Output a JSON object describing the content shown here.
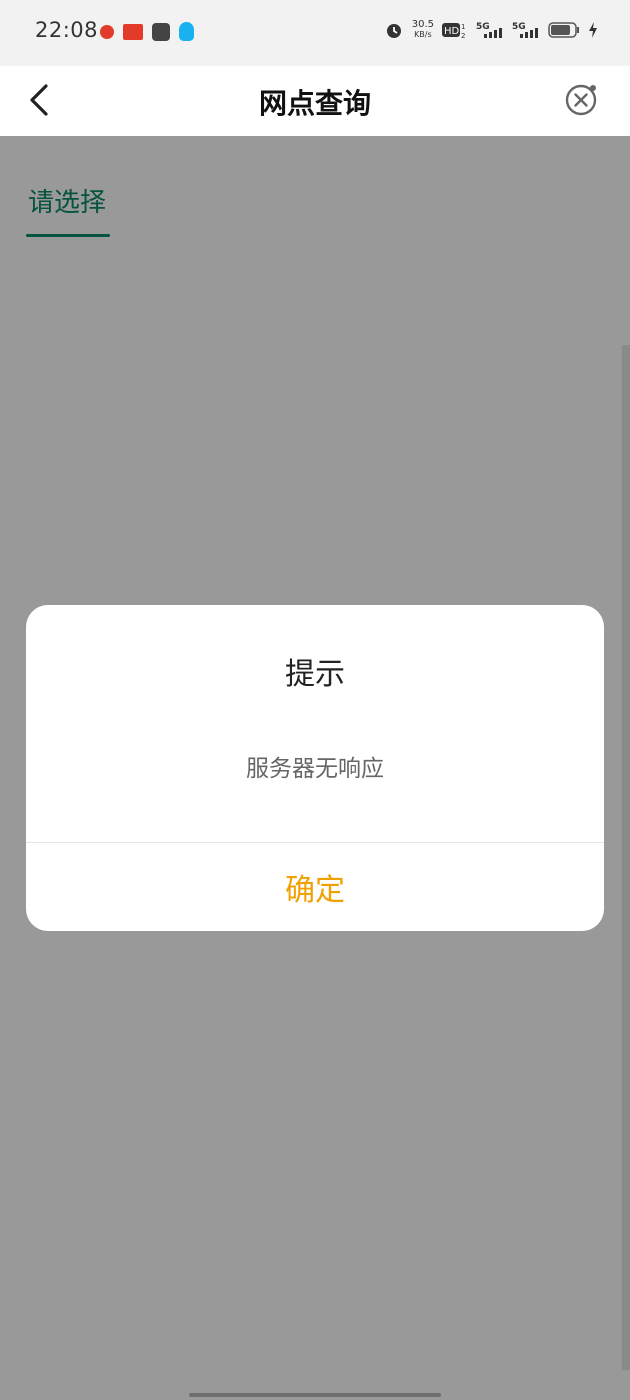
{
  "status_bar": {
    "time": "22:08",
    "net_speed_value": "30.5",
    "net_speed_unit": "KB/s",
    "icons": [
      "app-notification-icon",
      "toutiao-icon",
      "message-icon",
      "qq-icon",
      "alarm-icon",
      "hd-icon",
      "5g-signal-icon",
      "5g-signal-icon",
      "battery-icon",
      "charging-icon"
    ]
  },
  "header": {
    "title": "网点查询"
  },
  "content": {
    "tab_label": "请选择"
  },
  "dialog": {
    "title": "提示",
    "message": "服务器无响应",
    "confirm_label": "确定"
  },
  "colors": {
    "accent": "#0a8a6a",
    "confirm": "#f0a000",
    "mask": "rgba(0,0,0,0.40)"
  }
}
